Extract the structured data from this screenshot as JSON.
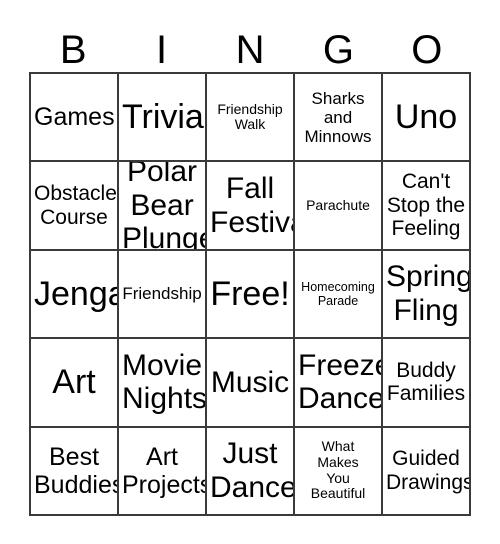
{
  "card": {
    "header_letters": [
      "B",
      "I",
      "N",
      "G",
      "O"
    ],
    "rows": [
      [
        {
          "label": "Games",
          "size": "lg"
        },
        {
          "label": "Trivia",
          "size": "xxl"
        },
        {
          "label": "Friendship\nWalk",
          "size": "xs"
        },
        {
          "label": "Sharks\nand\nMinnows",
          "size": "sm"
        },
        {
          "label": "Uno",
          "size": "xxl"
        }
      ],
      [
        {
          "label": "Obstacle\nCourse",
          "size": "md"
        },
        {
          "label": "Polar\nBear\nPlunge",
          "size": "xl"
        },
        {
          "label": "Fall\nFestival",
          "size": "xl"
        },
        {
          "label": "Parachute",
          "size": "xs"
        },
        {
          "label": "Can't\nStop the\nFeeling",
          "size": "md"
        }
      ],
      [
        {
          "label": "Jenga",
          "size": "xxl"
        },
        {
          "label": "Friendship",
          "size": "sm"
        },
        {
          "label": "Free!",
          "size": "xxl"
        },
        {
          "label": "Homecoming\nParade",
          "size": "xxs"
        },
        {
          "label": "Spring\nFling",
          "size": "xl"
        }
      ],
      [
        {
          "label": "Art",
          "size": "xxl"
        },
        {
          "label": "Movie\nNights",
          "size": "xl"
        },
        {
          "label": "Music",
          "size": "xl"
        },
        {
          "label": "Freeze\nDance",
          "size": "xl"
        },
        {
          "label": "Buddy\nFamilies",
          "size": "md"
        }
      ],
      [
        {
          "label": "Best\nBuddies",
          "size": "lg"
        },
        {
          "label": "Art\nProjects",
          "size": "lg"
        },
        {
          "label": "Just\nDance",
          "size": "xl"
        },
        {
          "label": "What\nMakes\nYou\nBeautiful",
          "size": "xs"
        },
        {
          "label": "Guided\nDrawings",
          "size": "md"
        }
      ]
    ]
  },
  "colors": {
    "background": "#ffffff",
    "grid_line": "#3a3a3a",
    "text": "#000000"
  }
}
